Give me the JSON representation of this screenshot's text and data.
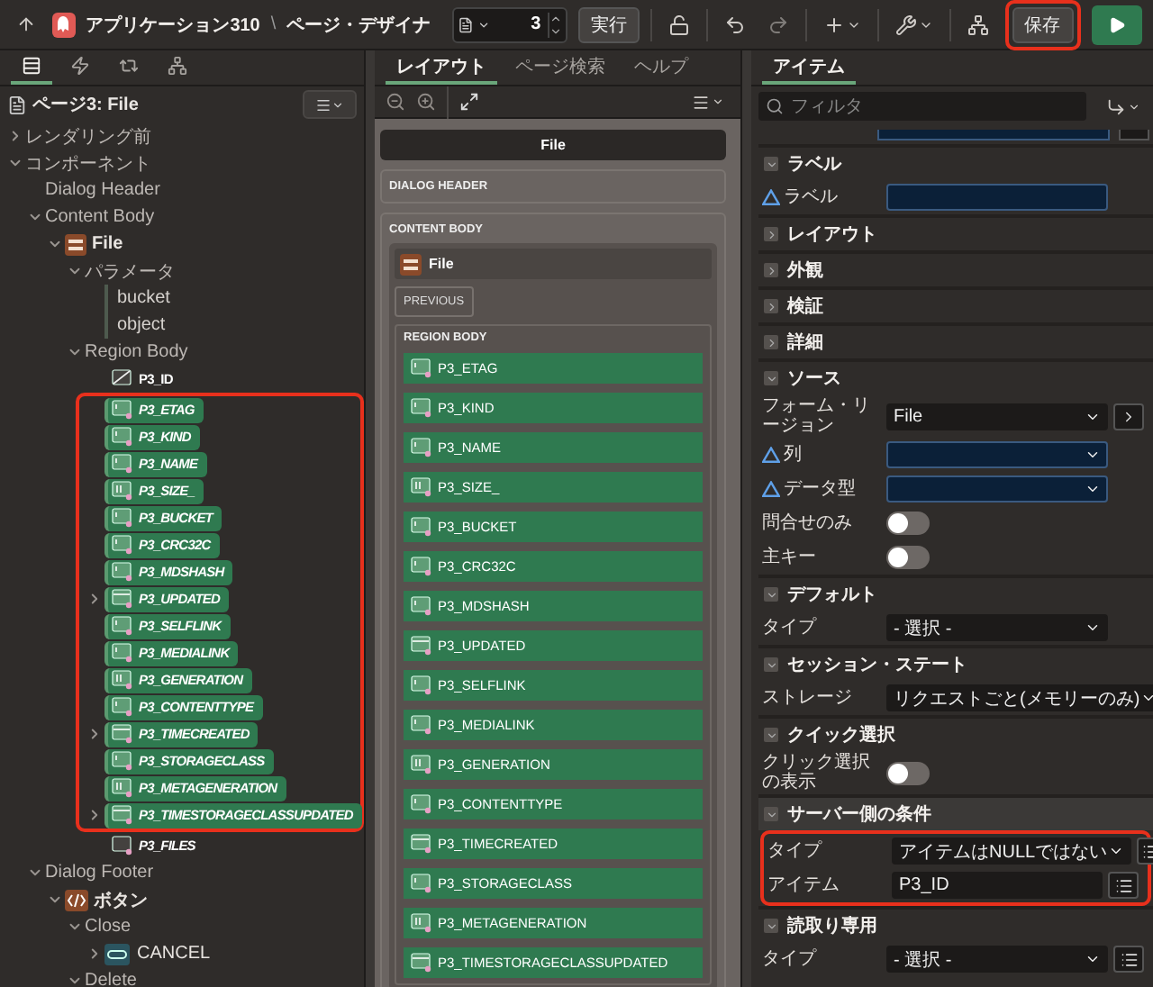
{
  "topbar": {
    "app": "アプリケーション310",
    "separator": "\\",
    "page": "ページ・デザイナ",
    "page_number": "3",
    "run_label": "実行",
    "save_label": "保存",
    "save_highlighted": true
  },
  "left": {
    "tabs": [
      {
        "selected": true
      },
      {
        "selected": false
      },
      {
        "selected": false
      },
      {
        "selected": false
      }
    ],
    "page_node": "ページ3: File",
    "tree": [
      {
        "label": "レンダリング前",
        "kind": "group",
        "expanded": false
      },
      {
        "label": "コンポーネント",
        "kind": "group",
        "expanded": true,
        "children": [
          {
            "label": "Dialog Header",
            "kind": "group"
          },
          {
            "label": "Content Body",
            "kind": "group",
            "expanded": true,
            "children": [
              {
                "label": "File",
                "kind": "region",
                "expanded": true,
                "children": [
                  {
                    "label": "パラメータ",
                    "kind": "group",
                    "expanded": true,
                    "children": [
                      {
                        "label": "bucket",
                        "kind": "param"
                      },
                      {
                        "label": "object",
                        "kind": "param"
                      }
                    ]
                  },
                  {
                    "label": "Region Body",
                    "kind": "group",
                    "expanded": true,
                    "children": [
                      {
                        "label": "P3_ID",
                        "kind": "hidden_item"
                      },
                      {
                        "kind": "highlight_group",
                        "children": [
                          {
                            "label": "P3_ETAG",
                            "kind": "text_item"
                          },
                          {
                            "label": "P3_KIND",
                            "kind": "text_item"
                          },
                          {
                            "label": "P3_NAME",
                            "kind": "text_item"
                          },
                          {
                            "label": "P3_SIZE_",
                            "kind": "number_item"
                          },
                          {
                            "label": "P3_BUCKET",
                            "kind": "text_item"
                          },
                          {
                            "label": "P3_CRC32C",
                            "kind": "text_item"
                          },
                          {
                            "label": "P3_MDSHASH",
                            "kind": "text_item"
                          },
                          {
                            "label": "P3_UPDATED",
                            "kind": "date_item",
                            "expanded": false
                          },
                          {
                            "label": "P3_SELFLINK",
                            "kind": "text_item"
                          },
                          {
                            "label": "P3_MEDIALINK",
                            "kind": "text_item"
                          },
                          {
                            "label": "P3_GENERATION",
                            "kind": "number_item"
                          },
                          {
                            "label": "P3_CONTENTTYPE",
                            "kind": "text_item"
                          },
                          {
                            "label": "P3_TIMECREATED",
                            "kind": "date_item",
                            "expanded": false
                          },
                          {
                            "label": "P3_STORAGECLASS",
                            "kind": "text_item"
                          },
                          {
                            "label": "P3_METAGENERATION",
                            "kind": "number_item"
                          },
                          {
                            "label": "P3_TIMESTORAGECLASSUPDATED",
                            "kind": "date_item",
                            "expanded": false
                          }
                        ]
                      },
                      {
                        "label": "P3_FILES",
                        "kind": "file_item"
                      }
                    ]
                  }
                ]
              }
            ]
          },
          {
            "label": "Dialog Footer",
            "kind": "group",
            "expanded": true,
            "children": [
              {
                "label": "ボタン",
                "kind": "buttons",
                "expanded": true,
                "children": [
                  {
                    "label": "Close",
                    "kind": "group",
                    "expanded": true,
                    "children": [
                      {
                        "label": "CANCEL",
                        "kind": "button",
                        "expanded": false
                      }
                    ]
                  },
                  {
                    "label": "Delete",
                    "kind": "group",
                    "expanded": true
                  }
                ]
              }
            ]
          }
        ]
      }
    ]
  },
  "middle": {
    "tabs": [
      {
        "label": "レイアウト",
        "selected": true
      },
      {
        "label": "ページ検索",
        "selected": false
      },
      {
        "label": "ヘルプ",
        "selected": false
      }
    ],
    "title": "File",
    "dialog_header": "DIALOG HEADER",
    "content_body": "CONTENT BODY",
    "region": "File",
    "previous": "PREVIOUS",
    "region_body": "REGION BODY",
    "items": [
      {
        "label": "P3_ETAG",
        "kind": "text_item"
      },
      {
        "label": "P3_KIND",
        "kind": "text_item"
      },
      {
        "label": "P3_NAME",
        "kind": "text_item"
      },
      {
        "label": "P3_SIZE_",
        "kind": "number_item"
      },
      {
        "label": "P3_BUCKET",
        "kind": "text_item"
      },
      {
        "label": "P3_CRC32C",
        "kind": "text_item"
      },
      {
        "label": "P3_MDSHASH",
        "kind": "text_item"
      },
      {
        "label": "P3_UPDATED",
        "kind": "date_item"
      },
      {
        "label": "P3_SELFLINK",
        "kind": "text_item"
      },
      {
        "label": "P3_MEDIALINK",
        "kind": "text_item"
      },
      {
        "label": "P3_GENERATION",
        "kind": "number_item"
      },
      {
        "label": "P3_CONTENTTYPE",
        "kind": "text_item"
      },
      {
        "label": "P3_TIMECREATED",
        "kind": "date_item"
      },
      {
        "label": "P3_STORAGECLASS",
        "kind": "text_item"
      },
      {
        "label": "P3_METAGENERATION",
        "kind": "number_item"
      },
      {
        "label": "P3_TIMESTORAGECLASSUPDATED",
        "kind": "date_item"
      }
    ]
  },
  "right": {
    "tabs": [
      {
        "label": "アイテム",
        "selected": true
      }
    ],
    "filter_placeholder": "フィルタ",
    "sections": [
      {
        "title": "ラベル",
        "expanded": true,
        "fields": [
          {
            "kind": "input",
            "label": "ラベル",
            "required": true
          }
        ]
      },
      {
        "title": "レイアウト",
        "expanded": false
      },
      {
        "title": "外観",
        "expanded": false
      },
      {
        "title": "検証",
        "expanded": false
      },
      {
        "title": "詳細",
        "expanded": false
      },
      {
        "title": "ソース",
        "expanded": true,
        "fields": [
          {
            "kind": "select",
            "label": "フォーム・リージョン",
            "value": "File",
            "go_button": true
          },
          {
            "kind": "select",
            "label": "列",
            "required": true
          },
          {
            "kind": "select",
            "label": "データ型",
            "required": true
          },
          {
            "kind": "toggle",
            "label": "問合せのみ",
            "on": false
          },
          {
            "kind": "toggle",
            "label": "主キー",
            "on": false
          }
        ]
      },
      {
        "title": "デフォルト",
        "expanded": true,
        "fields": [
          {
            "kind": "select",
            "label": "タイプ",
            "value": "- 選択 -"
          }
        ]
      },
      {
        "title": "セッション・ステート",
        "expanded": true,
        "fields": [
          {
            "kind": "select",
            "label": "ストレージ",
            "value": "リクエストごと(メモリーのみ)"
          }
        ]
      },
      {
        "title": "クイック選択",
        "expanded": true,
        "fields": [
          {
            "kind": "toggle",
            "label": "クリック選択の表示",
            "on": false
          }
        ]
      },
      {
        "title": "サーバー側の条件",
        "expanded": true,
        "highlighted": true,
        "fields": [
          {
            "kind": "select",
            "label": "タイプ",
            "value": "アイテムはNULLではない",
            "list_button": true
          },
          {
            "kind": "input",
            "label": "アイテム",
            "value": "P3_ID",
            "list_button": true
          }
        ]
      },
      {
        "title": "読取り専用",
        "expanded": true,
        "fields": [
          {
            "kind": "select",
            "label": "タイプ",
            "value": "- 選択 -",
            "list_button": true
          }
        ]
      }
    ]
  }
}
